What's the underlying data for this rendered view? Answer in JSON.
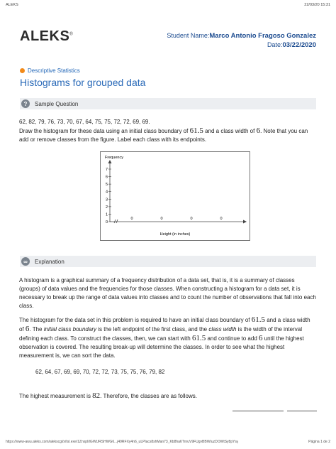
{
  "print_header": {
    "left": "ALEKS",
    "right": "22/03/20 15:31"
  },
  "logo": {
    "text": "ALEKS",
    "mark": "®"
  },
  "student": {
    "name_label": "Student Name:",
    "name_value": "Marco Antonio Fragoso Gonzalez",
    "date_label": "Date:",
    "date_value": "03/22/2020"
  },
  "topic": {
    "label": "Descriptive Statistics",
    "dot_color": "#f28a19"
  },
  "title": "Histograms for grouped data",
  "sample_bar": {
    "label": "Sample Question",
    "icon": "question-icon"
  },
  "question": {
    "data": "62, 82, 79, 76, 73, 70, 67, 64, 75, 75, 72, 72, 69, 69.",
    "p1": "Draw the histogram for these data using an initial class boundary of",
    "boundary": "61.5",
    "p2": "and a class width of",
    "width": "6",
    "p3": ". Note that you can add or remove classes from the figure. Label each class with its endpoints."
  },
  "chart": {
    "ylabel": "Frequency",
    "xlabel": "Height (in inches)",
    "yticks": [
      "7",
      "6",
      "5",
      "4",
      "3",
      "2",
      "1",
      "0"
    ],
    "bar_values": [
      "0",
      "0",
      "0",
      "0"
    ]
  },
  "explanation_bar": {
    "label": "Explanation",
    "icon": "infinity-icon"
  },
  "explanation": {
    "para1": "A histogram is a graphical summary of a frequency distribution of a data set, that is, it is a summary of classes (groups) of data values and the frequencies for those classes. When constructing a histogram for a data set, it is necessary to break up the range of data values into classes and to count the number of observations that fall into each class.",
    "p2a": "The histogram for the data set in this problem is required to have an initial class boundary of",
    "p2b": "and a class width of",
    "p2c": ". The",
    "p2d": "initial class boundary",
    "p2e": "is the left endpoint of the first class, and the",
    "p2f": "class width",
    "p2g": "is the width of the interval defining each class. To construct the classes, then, we can start with",
    "p2h": "and continue to add",
    "p2i": "until the highest observation is covered. The resulting break-up will determine the classes. In order to see what the highest measurement is, we can sort the data.",
    "sorted": "62, 64, 67, 69, 69, 70, 72, 72, 73, 75, 75, 76, 79, 82",
    "p3a": "The highest measurement is",
    "highest": "82",
    "p3b": ". Therefore, the classes are as follows."
  },
  "footer": {
    "url": "https://www-awu.aleks.com/alekscgi/x/Isl.exe/1Znxpl/IGWURSHWG6...j49RFXy4n6_uLPlacs8shMan73_Kb8ha6TnruV9FUgvBBWIuzDOWtSy8pYsy",
    "page": "Página 1 de 2"
  }
}
